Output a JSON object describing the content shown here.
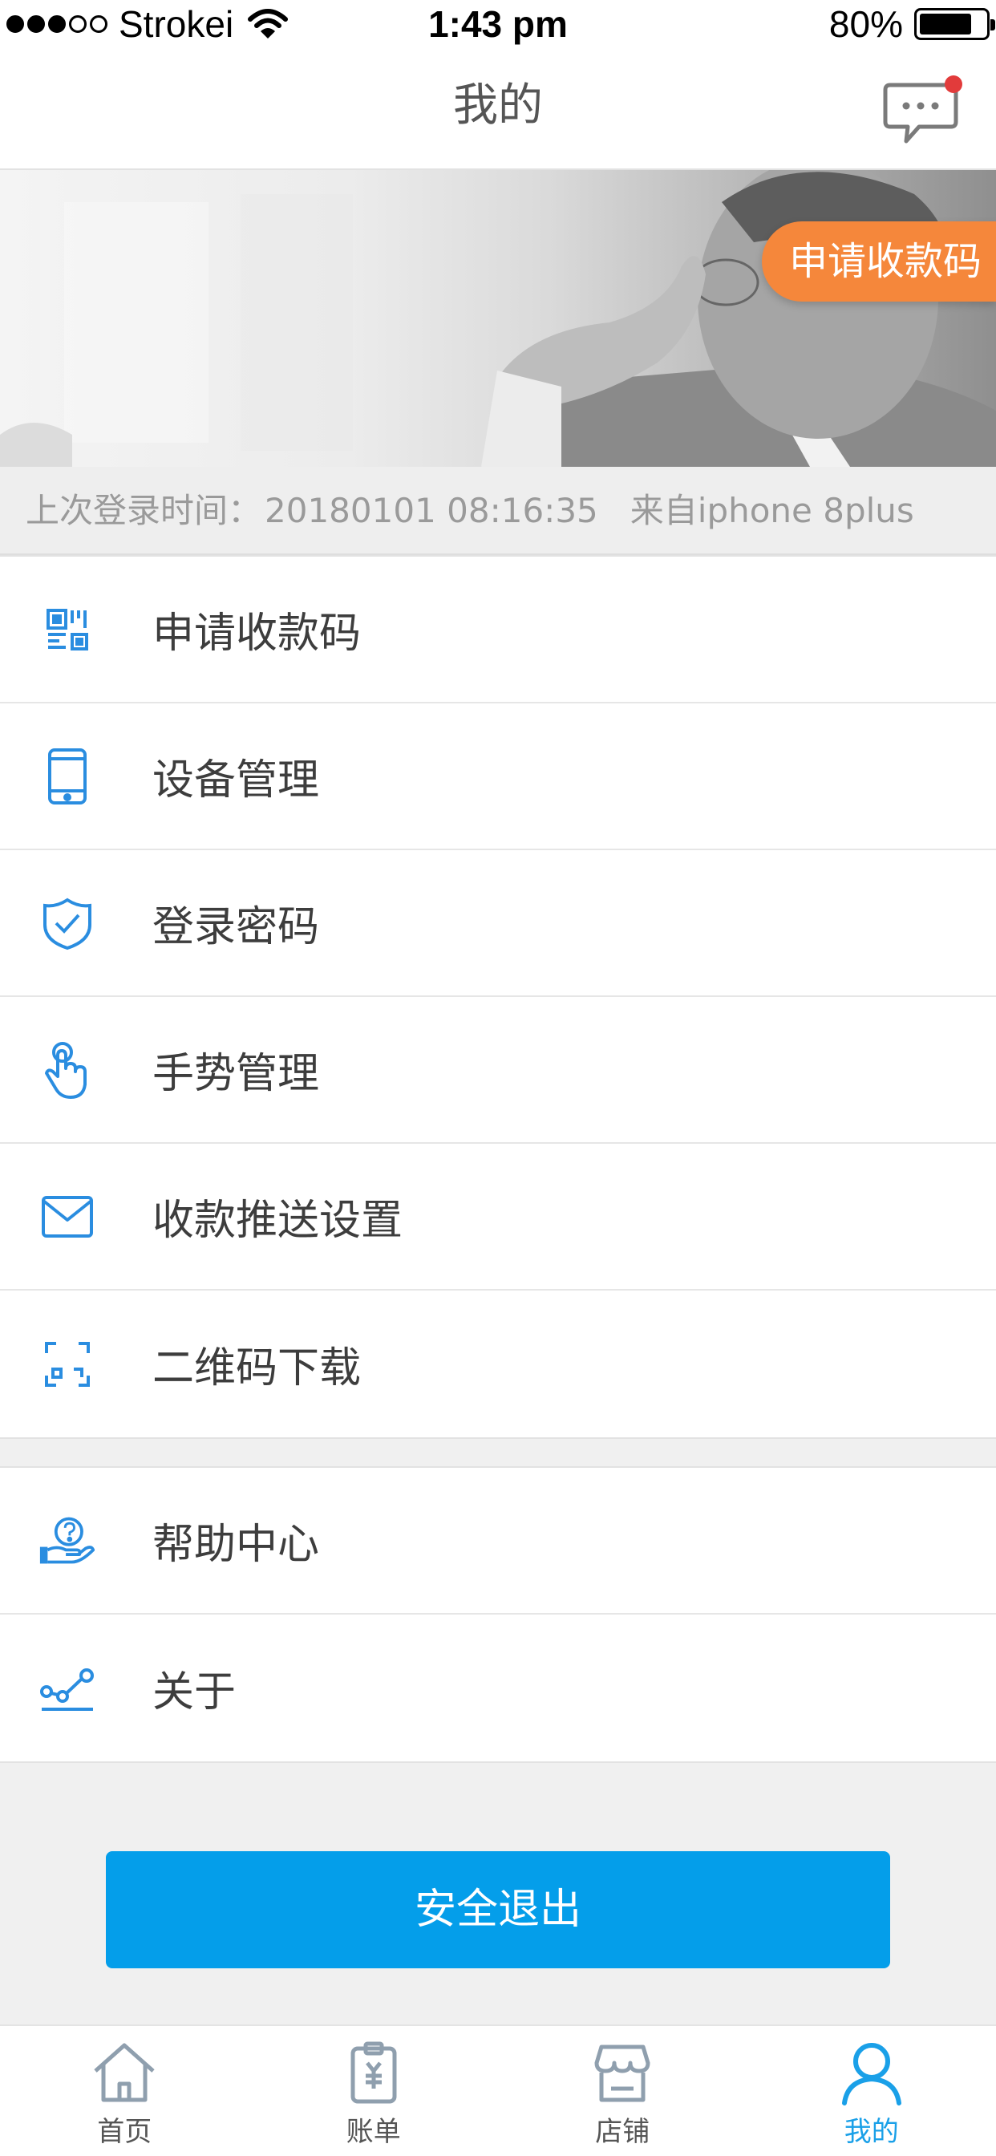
{
  "status_bar": {
    "carrier": "Strokei",
    "time": "1:43 pm",
    "battery_percent": "80%",
    "battery_level": 0.8,
    "signal_bars_filled": 3,
    "signal_bars_total": 5
  },
  "header": {
    "title": "我的",
    "message_icon": "chat-bubble-icon",
    "has_unread": true
  },
  "banner": {
    "apply_badge": "申请收款码"
  },
  "last_login": {
    "label": "上次登录时间：",
    "value": "20180101 08:16:35",
    "source": "来自iphone 8plus"
  },
  "menu": {
    "items": [
      {
        "label": "申请收款码",
        "icon": "qr-code-icon"
      },
      {
        "label": "设备管理",
        "icon": "phone-icon"
      },
      {
        "label": "登录密码",
        "icon": "shield-check-icon"
      },
      {
        "label": "手势管理",
        "icon": "finger-touch-icon"
      },
      {
        "label": "收款推送设置",
        "icon": "envelope-icon"
      },
      {
        "label": "二维码下载",
        "icon": "scan-frame-icon"
      }
    ],
    "items2": [
      {
        "label": "帮助中心",
        "icon": "help-hand-icon"
      },
      {
        "label": "关于",
        "icon": "nodes-icon"
      }
    ]
  },
  "logout": {
    "label": "安全退出"
  },
  "tabs": [
    {
      "label": "首页",
      "icon": "home-icon",
      "active": false
    },
    {
      "label": "账单",
      "icon": "bill-icon",
      "active": false
    },
    {
      "label": "店铺",
      "icon": "store-icon",
      "active": false
    },
    {
      "label": "我的",
      "icon": "user-icon",
      "active": true
    }
  ],
  "colors": {
    "accent": "#049eea",
    "badge": "#f5873b",
    "icon_blue": "#2a8de0",
    "tab_active": "#1aa0e8",
    "unread_dot": "#e23b3b"
  }
}
